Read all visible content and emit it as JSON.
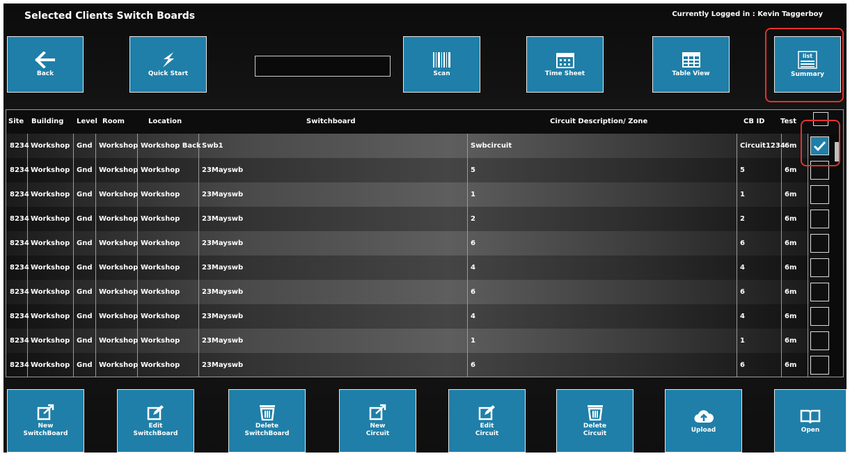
{
  "header": {
    "title": "Selected Clients Switch Boards",
    "logged_in": "Currently Logged in : Kevin Taggerboy"
  },
  "toolbar": {
    "back": "Back",
    "quick_start": "Quick Start",
    "scan": "Scan",
    "time_sheet": "Time Sheet",
    "table_view": "Table View",
    "summary": "Summary",
    "summary_icon_text": "list",
    "search_value": ""
  },
  "table": {
    "columns": {
      "site": "Site",
      "building": "Building",
      "level": "Level",
      "room": "Room",
      "location": "Location",
      "switchboard": "Switchboard",
      "circuit": "Circuit Description/ Zone",
      "cb_id": "CB ID",
      "test": "Test"
    },
    "rows": [
      {
        "site": "8234",
        "building": "Workshop",
        "level": "Gnd",
        "room": "Workshop",
        "location": "Workshop Back",
        "switchboard": "Swb1",
        "circuit": "Swbcircuit",
        "cb_id": "Circuit1234",
        "test": "6m",
        "checked": true
      },
      {
        "site": "8234",
        "building": "Workshop",
        "level": "Gnd",
        "room": "Workshop",
        "location": "Workshop",
        "switchboard": "23Mayswb",
        "circuit": "5",
        "cb_id": "5",
        "test": "6m",
        "checked": false
      },
      {
        "site": "8234",
        "building": "Workshop",
        "level": "Gnd",
        "room": "Workshop",
        "location": "Workshop",
        "switchboard": "23Mayswb",
        "circuit": "1",
        "cb_id": "1",
        "test": "6m",
        "checked": false
      },
      {
        "site": "8234",
        "building": "Workshop",
        "level": "Gnd",
        "room": "Workshop",
        "location": "Workshop",
        "switchboard": "23Mayswb",
        "circuit": "2",
        "cb_id": "2",
        "test": "6m",
        "checked": false
      },
      {
        "site": "8234",
        "building": "Workshop",
        "level": "Gnd",
        "room": "Workshop",
        "location": "Workshop",
        "switchboard": "23Mayswb",
        "circuit": "6",
        "cb_id": "6",
        "test": "6m",
        "checked": false
      },
      {
        "site": "8234",
        "building": "Workshop",
        "level": "Gnd",
        "room": "Workshop",
        "location": "Workshop",
        "switchboard": "23Mayswb",
        "circuit": "4",
        "cb_id": "4",
        "test": "6m",
        "checked": false
      },
      {
        "site": "8234",
        "building": "Workshop",
        "level": "Gnd",
        "room": "Workshop",
        "location": "Workshop",
        "switchboard": "23Mayswb",
        "circuit": "6",
        "cb_id": "6",
        "test": "6m",
        "checked": false
      },
      {
        "site": "8234",
        "building": "Workshop",
        "level": "Gnd",
        "room": "Workshop",
        "location": "Workshop",
        "switchboard": "23Mayswb",
        "circuit": "4",
        "cb_id": "4",
        "test": "6m",
        "checked": false
      },
      {
        "site": "8234",
        "building": "Workshop",
        "level": "Gnd",
        "room": "Workshop",
        "location": "Workshop",
        "switchboard": "23Mayswb",
        "circuit": "1",
        "cb_id": "1",
        "test": "6m",
        "checked": false
      },
      {
        "site": "8234",
        "building": "Workshop",
        "level": "Gnd",
        "room": "Workshop",
        "location": "Workshop",
        "switchboard": "23Mayswb",
        "circuit": "6",
        "cb_id": "6",
        "test": "6m",
        "checked": false
      }
    ]
  },
  "bottom_bar": [
    {
      "line1": "New",
      "line2": "SwitchBoard",
      "icon": "new-icon"
    },
    {
      "line1": "Edit",
      "line2": "SwitchBoard",
      "icon": "edit-icon"
    },
    {
      "line1": "Delete",
      "line2": "SwitchBoard",
      "icon": "trash-icon"
    },
    {
      "line1": "New",
      "line2": "Circuit",
      "icon": "new-icon"
    },
    {
      "line1": "Edit",
      "line2": "Circuit",
      "icon": "edit-icon"
    },
    {
      "line1": "Delete",
      "line2": "Circuit",
      "icon": "trash-icon"
    },
    {
      "line1": "Upload",
      "line2": "",
      "icon": "cloud-upload-icon"
    },
    {
      "line1": "Open",
      "line2": "",
      "icon": "book-open-icon"
    }
  ],
  "colors": {
    "accent": "#1f7fa8",
    "highlight": "#e53030"
  }
}
